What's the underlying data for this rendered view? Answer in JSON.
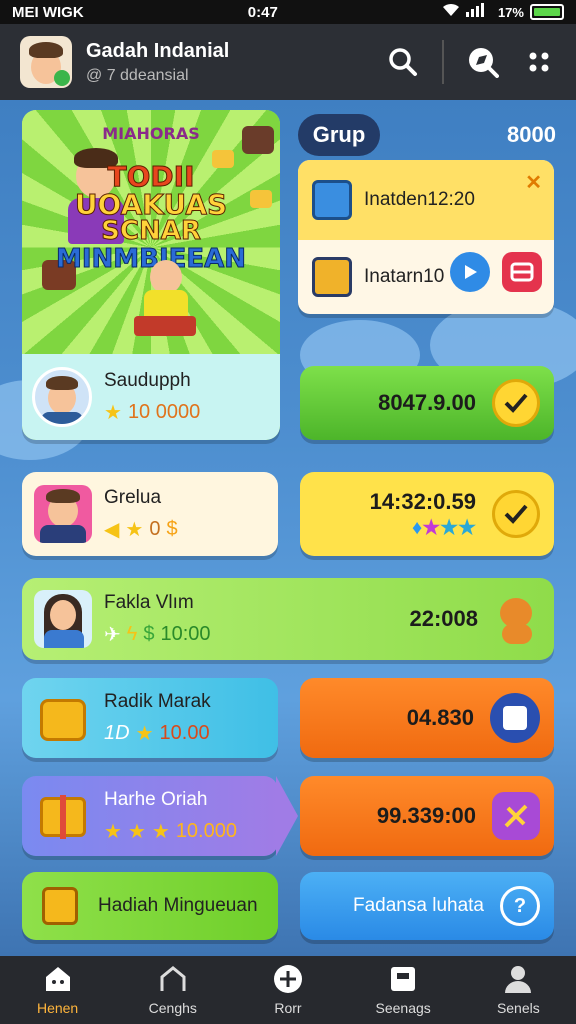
{
  "status_bar": {
    "carrier": "MEI WIGK",
    "time": "0:47",
    "battery_label": "17%"
  },
  "header": {
    "title": "Gadah Indanial",
    "subtitle": "@ 7 ddeansial"
  },
  "featured": {
    "banner_lines": [
      "MIAHORAS",
      "TODII",
      "UOAKUAS",
      "SCNAR",
      "MINMBIEEAN"
    ],
    "player_name": "Saudupph",
    "player_points": "10 0000"
  },
  "group": {
    "label": "Grup",
    "value": "8000"
  },
  "notifications": [
    {
      "text": "Inatden12:20"
    },
    {
      "text": "Inatarn10"
    }
  ],
  "rows": [
    {
      "left_name": "Grelua",
      "left_points": "0",
      "right_value": "14:32:0.59"
    },
    {
      "left_name": "Fakla Vlım",
      "left_points": "10:00",
      "right_value": "22:008"
    },
    {
      "left_name": "Radik Marak",
      "left_points": "10.00",
      "left_prefix": "1D",
      "right_value": "04.830"
    },
    {
      "left_name": "Harhe Oriah",
      "left_points": "10.000",
      "right_value": "99.339:00"
    },
    {
      "left_name": "Hadiah Mingueuan",
      "right_value": "Fadansa luhata"
    }
  ],
  "featured_right_value": "8047.9.00",
  "nav": [
    {
      "label": "Henen"
    },
    {
      "label": "Cenghs"
    },
    {
      "label": "Rorr"
    },
    {
      "label": "Seenags"
    },
    {
      "label": "Senels"
    }
  ],
  "colors": {
    "green": "#6bcf3a",
    "yellow": "#ffd83d",
    "orange": "#ff7a1c",
    "blue": "#2a98f0",
    "purple": "#8a5ce6",
    "accent_nav": "#ffb53c"
  }
}
